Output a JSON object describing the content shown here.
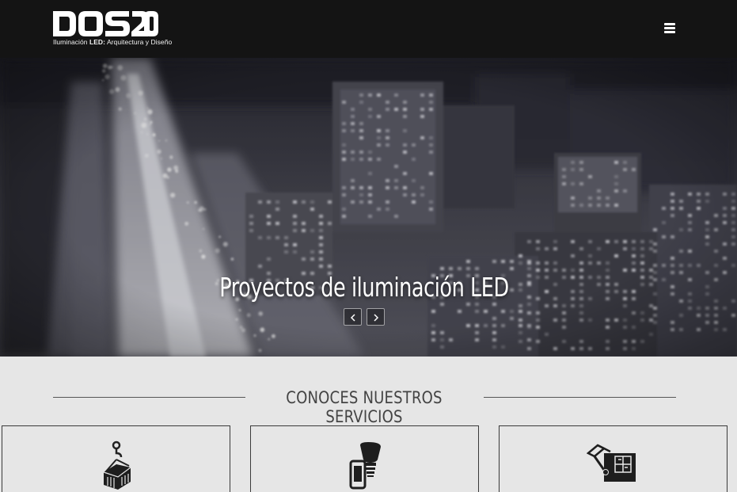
{
  "header": {
    "logo_text": "DOS20",
    "tagline_prefix": "Iluminación ",
    "tagline_bold": "LED:",
    "tagline_suffix": " Arquitectura y Diseño",
    "menu_icon": "hamburger-menu-icon"
  },
  "hero": {
    "title": "Proyectos de iluminación LED",
    "prev_icon": "chevron-left-icon",
    "next_icon": "chevron-right-icon"
  },
  "services": {
    "heading": "CONOCES NUESTROS SERVICIOS",
    "cards": [
      {
        "icon": "hanging-container-icon"
      },
      {
        "icon": "led-bulb-phone-icon"
      },
      {
        "icon": "blueprint-drafting-icon"
      }
    ]
  },
  "colors": {
    "header_bg": "#141414",
    "section_bg": "#e6e6e6",
    "text_dark": "#444444"
  }
}
